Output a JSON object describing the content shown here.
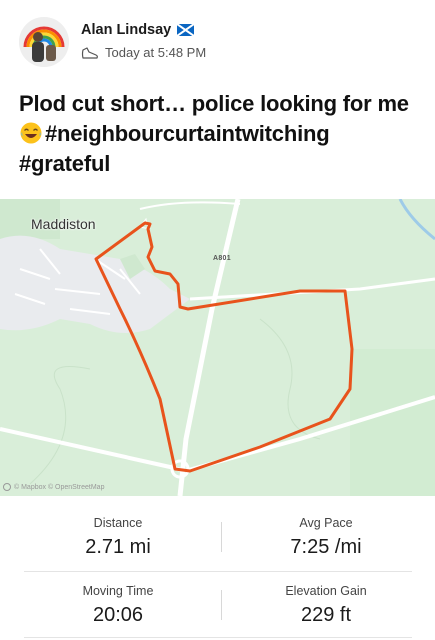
{
  "post": {
    "author": "Alan Lindsay",
    "timestamp": "Today at 5:48 PM",
    "title_text": "Plod cut short… police looking for me ",
    "title_hashtags": "#neighbourcurtaintwitching #grateful"
  },
  "map": {
    "town_label": "Maddiston",
    "road_label": "A801",
    "attribution": "© Mapbox © OpenStreetMap",
    "route_color": "#e8531c"
  },
  "stats": {
    "distance_label": "Distance",
    "distance_value": "2.71 mi",
    "pace_label": "Avg Pace",
    "pace_value": "7:25 /mi",
    "moving_time_label": "Moving Time",
    "moving_time_value": "20:06",
    "elevation_label": "Elevation Gain",
    "elevation_value": "229 ft"
  },
  "icons": {
    "flag": "scotland-flag-icon",
    "activity": "shoe-icon",
    "emoji": "laughing-emoji-icon"
  }
}
